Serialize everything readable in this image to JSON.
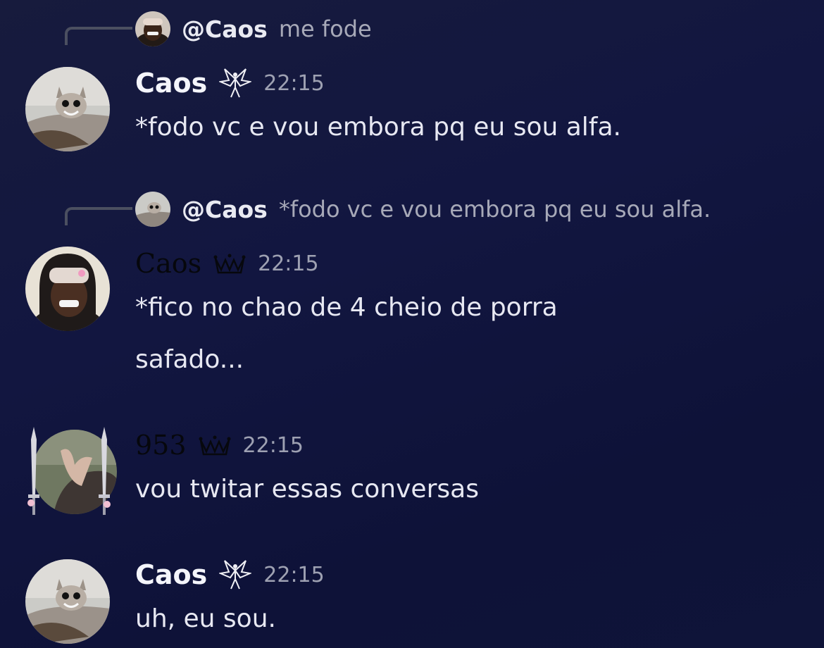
{
  "messages": [
    {
      "reply": {
        "name": "@Caos",
        "text": "me fode"
      },
      "author": "Caos",
      "badge": "fairy-badge-icon",
      "time": "22:15",
      "lines": [
        "*fodo vc e vou embora pq eu sou alfa."
      ]
    },
    {
      "reply": {
        "name": "@Caos",
        "text": "*fodo vc e vou embora pq eu sou alfa."
      },
      "author": "Caos",
      "badge": "crown-badge-icon",
      "time": "22:15",
      "lines": [
        "*fico no chao de 4 cheio de porra",
        "safado..."
      ]
    },
    {
      "author": "953",
      "badge": "crown-badge-icon",
      "time": "22:15",
      "lines": [
        "vou twitar essas conversas"
      ]
    },
    {
      "author": "Caos",
      "badge": "fairy-badge-icon",
      "time": "22:15",
      "lines": [
        "uh, eu sou."
      ]
    }
  ],
  "colors": {
    "background": "#121640",
    "text": "#e7e8f2",
    "muted": "#9ea1b2",
    "reply_line": "#4b4f60"
  }
}
